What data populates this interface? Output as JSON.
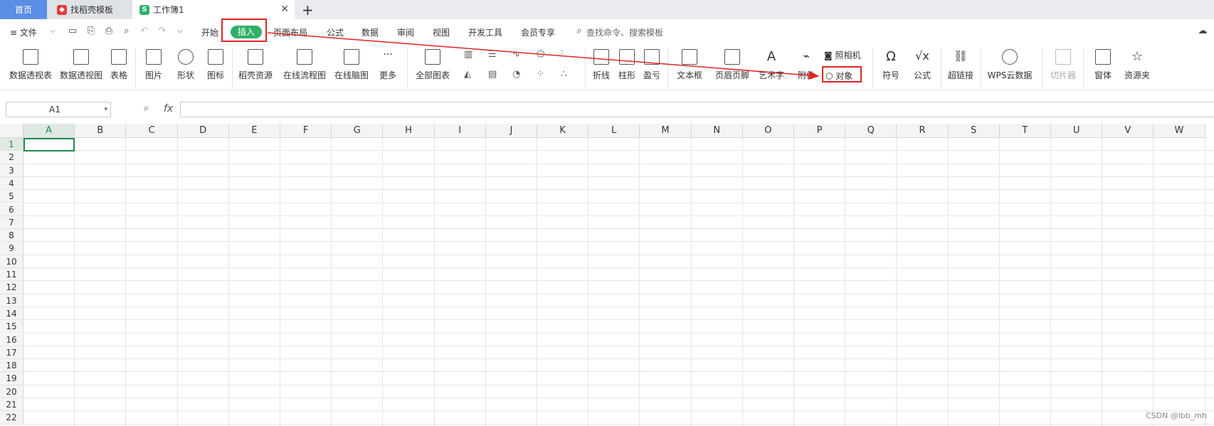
{
  "tabs": [
    {
      "label": "首页"
    },
    {
      "label": "找稻壳模板"
    },
    {
      "label": "工作簿1"
    }
  ],
  "tab_close": "✕",
  "tab_add": "+",
  "menu": {
    "file": "≡ 文件",
    "items": [
      "开始",
      "插入",
      "页面布局",
      "公式",
      "数据",
      "审阅",
      "视图",
      "开发工具",
      "会员专享"
    ],
    "search": "查找命令、搜索模板"
  },
  "ribbon": {
    "pivot_table": "数据透视表",
    "pivot_chart": "数据透视图",
    "table": "表格",
    "picture": "图片",
    "shape": "形状",
    "icon": "图标",
    "docer_resources": "稻壳资源",
    "flowchart": "在线流程图",
    "mindmap": "在线脑图",
    "more": "更多",
    "all_charts": "全部图表",
    "line": "折线",
    "column": "柱形",
    "winloss": "盈亏",
    "textbox": "文本框",
    "header_footer": "页眉页脚",
    "wordart": "艺术字",
    "attachment": "附件",
    "camera": "照相机",
    "object": "对象",
    "symbol": "符号",
    "formula": "公式",
    "hyperlink": "超链接",
    "wps_cloud_data": "WPS云数据",
    "slicer": "切片器",
    "form": "窗体",
    "resource_folder": "资源夹"
  },
  "formula_bar": {
    "cell_ref": "A1",
    "fx": "fx"
  },
  "columns": [
    "A",
    "B",
    "C",
    "D",
    "E",
    "F",
    "G",
    "H",
    "I",
    "J",
    "K",
    "L",
    "M",
    "N",
    "O",
    "P",
    "Q",
    "R",
    "S",
    "T",
    "U",
    "V",
    "W"
  ],
  "rows": [
    "1",
    "2",
    "3",
    "4",
    "5",
    "6",
    "7",
    "8",
    "9",
    "10",
    "11",
    "12",
    "13",
    "14",
    "15",
    "16",
    "17",
    "18",
    "19",
    "20",
    "21",
    "22"
  ],
  "watermark": "CSDN @lbb_mh",
  "colors": {
    "accent_green": "#2fb06a",
    "home_tab_blue": "#5b8fe6",
    "annotation_red": "#e02424"
  }
}
